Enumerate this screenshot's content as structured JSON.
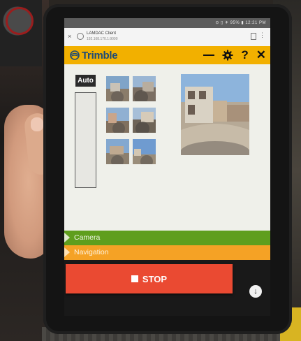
{
  "browser": {
    "title": "LAMDAC Client",
    "url": "192.168.170.1:9000",
    "status_text": "⊙ ▯ ✈ 95% ▮ 12:21 PM",
    "close_glyph": "×",
    "menu_glyph": "⋮"
  },
  "app": {
    "logo_text": "Trimble",
    "header_icons": [
      "list-icon",
      "gear-icon",
      "help-icon",
      "close-icon"
    ],
    "help_glyph": "?",
    "close_glyph": "✕",
    "gear_glyph": "✸"
  },
  "camera_panel": {
    "auto_label": "Auto"
  },
  "sections": {
    "camera_label": "Camera",
    "navigation_label": "Navigation"
  },
  "controls": {
    "stop_label": "STOP",
    "down_glyph": "↓"
  },
  "colors": {
    "header": "#f2b000",
    "camera_bar": "#5f9e1d",
    "navigation_bar": "#f5a225",
    "stop_button": "#ea4a32",
    "logo_text": "#1d4a77"
  }
}
